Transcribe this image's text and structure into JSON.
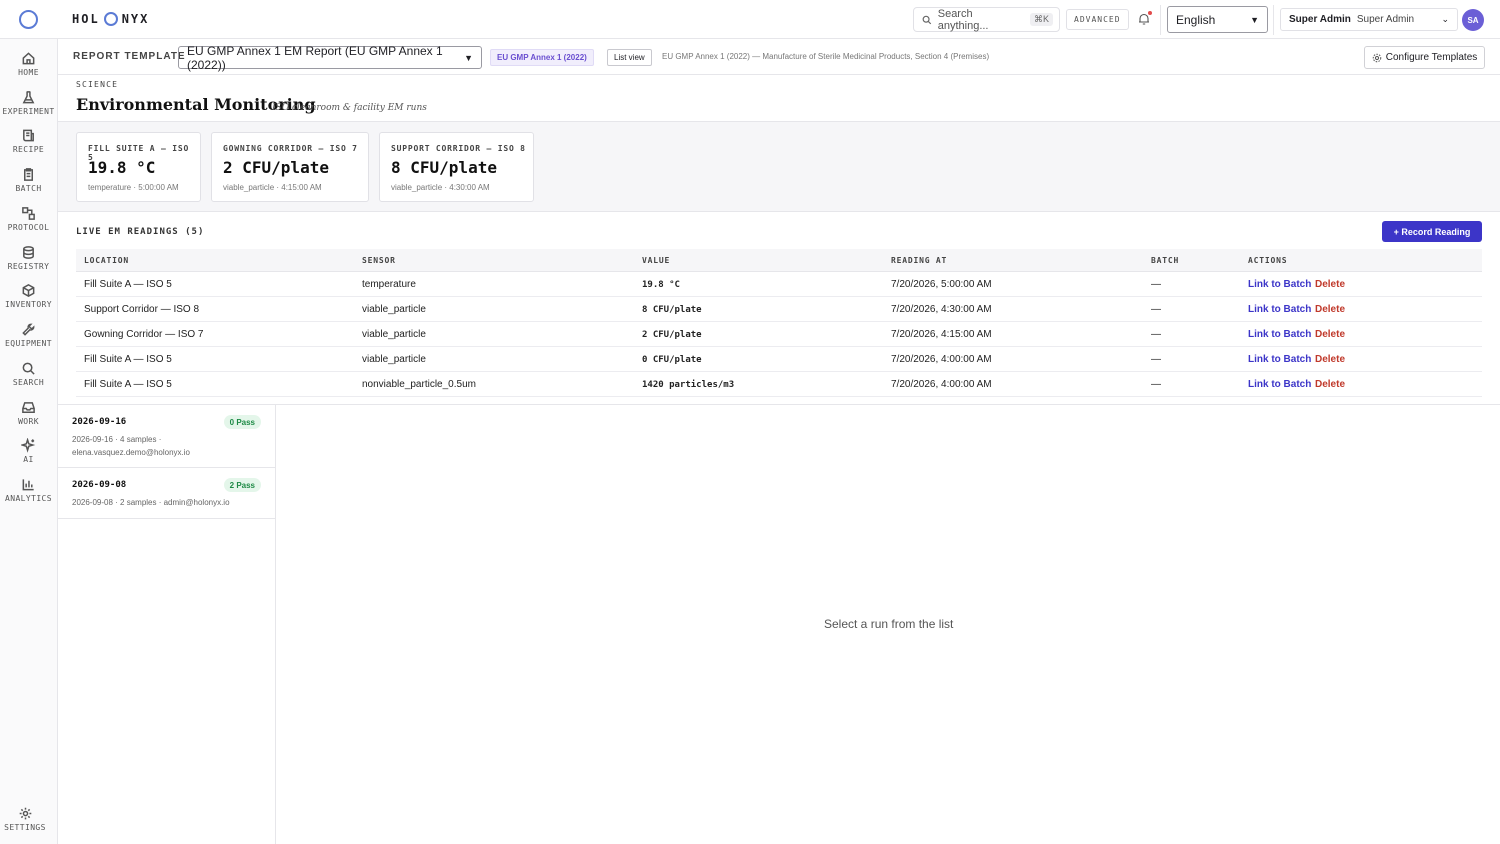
{
  "app": {
    "brand_left": "HOL",
    "brand_right": "NYX"
  },
  "topbar": {
    "search_placeholder": "Search anything...",
    "search_shortcut": "⌘K",
    "advanced_label": "ADVANCED",
    "language": "English",
    "user_role": "Super Admin",
    "user_name": "Super Admin",
    "avatar_initials": "SA"
  },
  "sidebar": {
    "items": [
      {
        "label": "HOME",
        "icon": "home-icon"
      },
      {
        "label": "EXPERIMENT",
        "icon": "flask-icon"
      },
      {
        "label": "RECIPE",
        "icon": "recipe-icon"
      },
      {
        "label": "BATCH",
        "icon": "clipboard-icon"
      },
      {
        "label": "PROTOCOL",
        "icon": "protocol-icon"
      },
      {
        "label": "REGISTRY",
        "icon": "database-icon"
      },
      {
        "label": "INVENTORY",
        "icon": "box-icon"
      },
      {
        "label": "EQUIPMENT",
        "icon": "wrench-icon"
      },
      {
        "label": "SEARCH",
        "icon": "search-icon"
      },
      {
        "label": "WORK",
        "icon": "inbox-icon"
      },
      {
        "label": "AI",
        "icon": "sparkle-icon"
      },
      {
        "label": "ANALYTICS",
        "icon": "bar-chart-icon"
      }
    ],
    "settings_label": "SETTINGS"
  },
  "template_bar": {
    "label": "REPORT TEMPLATE",
    "selected": "EU GMP Annex 1 EM Report (EU GMP Annex 1 (2022))",
    "badge": "EU GMP Annex 1 (2022)",
    "list_view": "List view",
    "description": "EU GMP Annex 1 (2022) — Manufacture of Sterile Medicinal Products, Section 4 (Premises)",
    "configure_label": "Configure Templates"
  },
  "header": {
    "eyebrow": "SCIENCE",
    "title": "Environmental Monitoring",
    "subtitle": "ISO cleanroom & facility EM runs"
  },
  "cards": [
    {
      "key": "FILL SUITE A — ISO 5",
      "value": "19.8 °C",
      "meta": "temperature · 5:00:00 AM"
    },
    {
      "key": "GOWNING CORRIDOR — ISO 7",
      "value": "2 CFU/plate",
      "meta": "viable_particle · 4:15:00 AM"
    },
    {
      "key": "SUPPORT CORRIDOR — ISO 8",
      "value": "8 CFU/plate",
      "meta": "viable_particle · 4:30:00 AM"
    }
  ],
  "readings": {
    "title": "LIVE EM READINGS (5)",
    "record_label": "+ Record Reading",
    "columns": [
      "LOCATION",
      "SENSOR",
      "VALUE",
      "READING AT",
      "BATCH",
      "ACTIONS"
    ],
    "link_label": "Link to Batch",
    "delete_label": "Delete",
    "rows": [
      {
        "location": "Fill Suite A — ISO 5",
        "sensor": "temperature",
        "value": "19.8 °C",
        "reading_at": "7/20/2026, 5:00:00 AM",
        "batch": "—"
      },
      {
        "location": "Support Corridor — ISO 8",
        "sensor": "viable_particle",
        "value": "8 CFU/plate",
        "reading_at": "7/20/2026, 4:30:00 AM",
        "batch": "—"
      },
      {
        "location": "Gowning Corridor — ISO 7",
        "sensor": "viable_particle",
        "value": "2 CFU/plate",
        "reading_at": "7/20/2026, 4:15:00 AM",
        "batch": "—"
      },
      {
        "location": "Fill Suite A — ISO 5",
        "sensor": "viable_particle",
        "value": "0 CFU/plate",
        "reading_at": "7/20/2026, 4:00:00 AM",
        "batch": "—"
      },
      {
        "location": "Fill Suite A — ISO 5",
        "sensor": "nonviable_particle_0.5um",
        "value": "1420 particles/m3",
        "reading_at": "7/20/2026, 4:00:00 AM",
        "batch": "—"
      }
    ]
  },
  "runs": [
    {
      "date": "2026-09-16",
      "pass": "0 Pass",
      "meta": "2026-09-16 · 4 samples · elena.vasquez.demo@holonyx.io"
    },
    {
      "date": "2026-09-08",
      "pass": "2 Pass",
      "meta": "2026-09-08 · 2 samples · admin@holonyx.io"
    }
  ],
  "empty_message": "Select a run from the list"
}
